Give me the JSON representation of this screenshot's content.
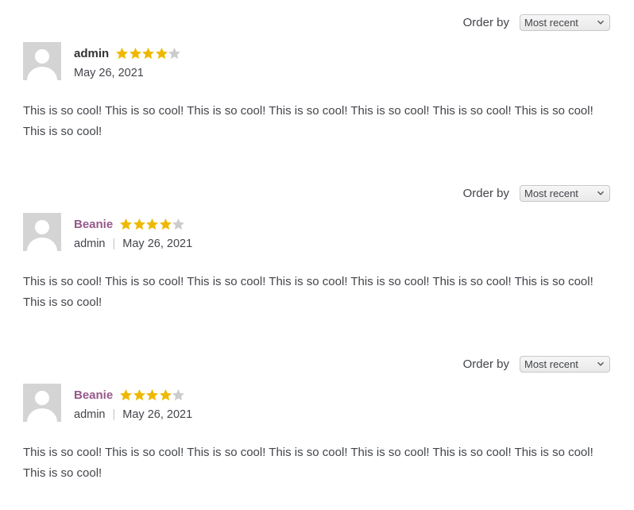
{
  "order_label": "Order by",
  "order_value": "Most recent",
  "star_color": "#eeb800",
  "star_empty_color": "#cccccc",
  "reviews": [
    {
      "author": "admin",
      "rating": 4,
      "rating_max": 5,
      "date": "May 26, 2021",
      "text": "This is so cool! This is so cool! This is so cool! This is so cool! This is so cool! This is so cool! This is so cool! This is so cool!"
    },
    {
      "author": "Beanie",
      "byline": "admin",
      "rating": 4,
      "rating_max": 5,
      "date": "May 26, 2021",
      "text": "This is so cool! This is so cool! This is so cool! This is so cool! This is so cool! This is so cool! This is so cool! This is so cool!"
    },
    {
      "author": "Beanie",
      "byline": "admin",
      "rating": 4,
      "rating_max": 5,
      "date": "May 26, 2021",
      "text": "This is so cool! This is so cool! This is so cool! This is so cool! This is so cool! This is so cool! This is so cool! This is so cool!"
    }
  ]
}
